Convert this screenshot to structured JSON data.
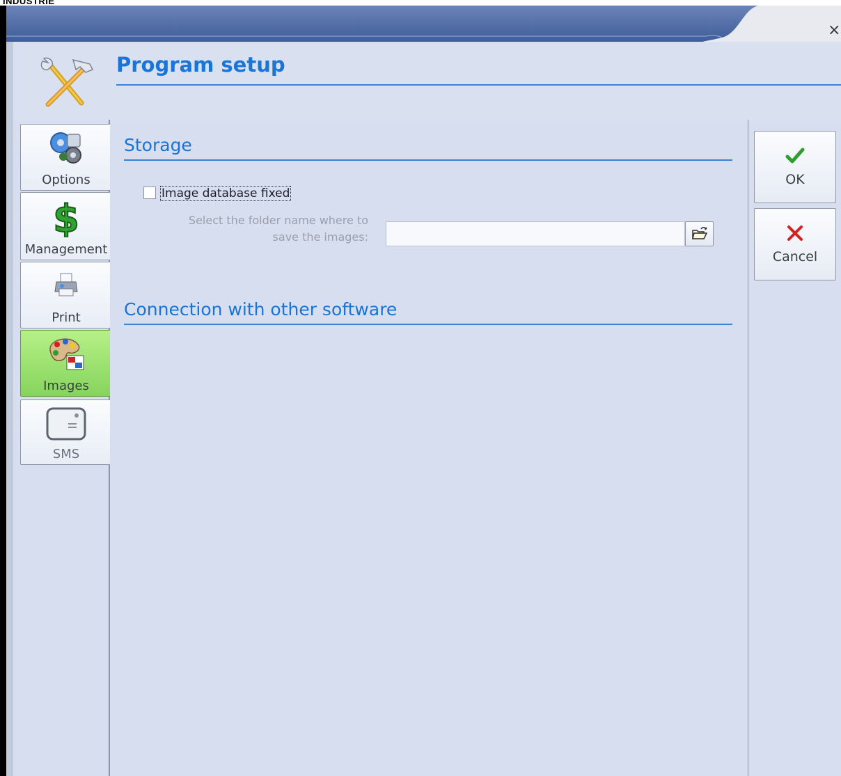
{
  "page": {
    "clipped_top_text": "INDUSTRIE",
    "close_glyph": "×"
  },
  "header": {
    "title": "Program setup",
    "icon": "tools-icon"
  },
  "sidebar": {
    "items": [
      {
        "label": "Options",
        "icon": "options-gears-icon",
        "state": "normal"
      },
      {
        "label": "Management",
        "icon": "dollar-icon",
        "state": "normal"
      },
      {
        "label": "Print",
        "icon": "printer-icon",
        "state": "normal"
      },
      {
        "label": "Images",
        "icon": "palette-icon",
        "state": "selected"
      },
      {
        "label": "SMS",
        "icon": "sms-device-icon",
        "state": "disabled"
      }
    ]
  },
  "main": {
    "storage_title": "Storage",
    "checkbox_label": "Image database fixed",
    "checkbox_checked": false,
    "folder_label_line1": "Select the folder name where to",
    "folder_label_line2": "save the images:",
    "folder_value": "",
    "browse_icon": "open-folder-icon",
    "connection_title": "Connection with other software"
  },
  "actions": {
    "ok_label": "OK",
    "ok_icon": "checkmark-icon",
    "cancel_label": "Cancel",
    "cancel_icon": "red-x-icon"
  },
  "colors": {
    "accent_blue": "#1B75D8",
    "panel_bg": "#D6DEEF",
    "selected_green": "#9BE070",
    "check_green": "#2E9E2E",
    "cancel_red": "#D42020"
  }
}
